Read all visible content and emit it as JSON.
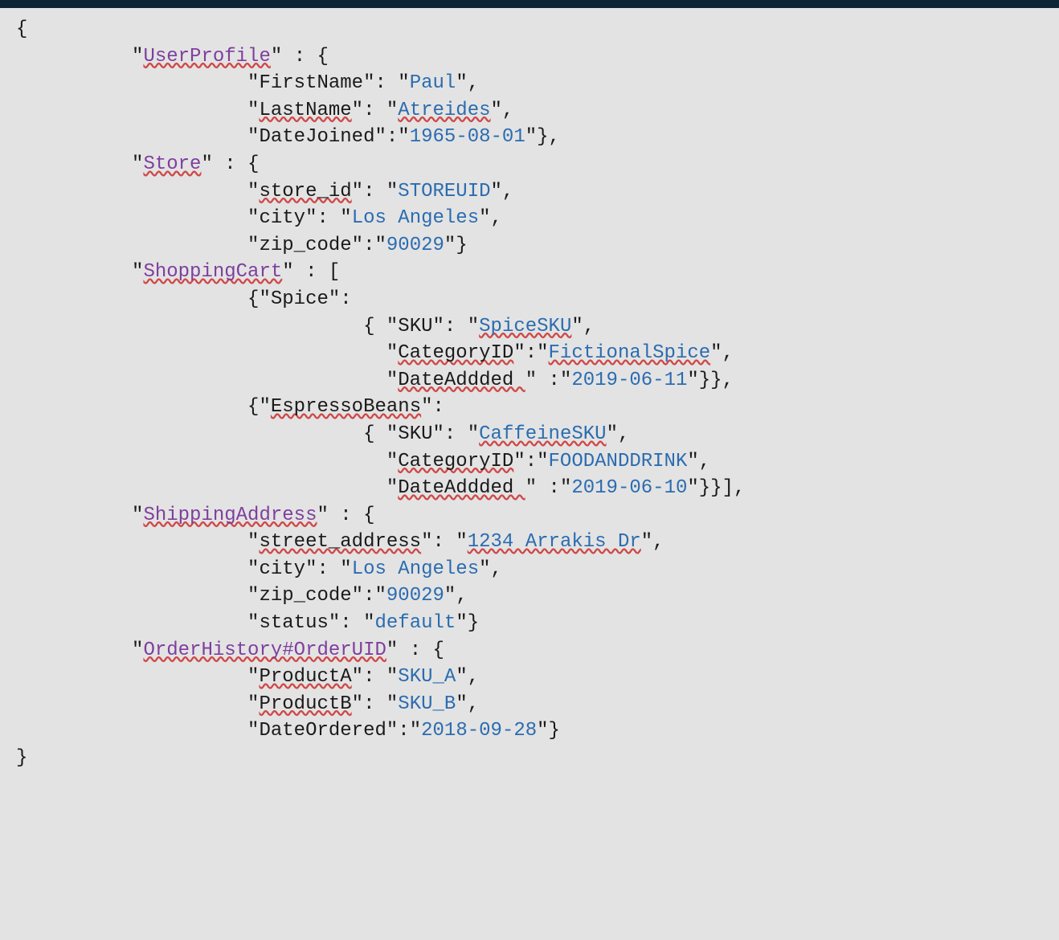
{
  "userProfile": {
    "key": "UserProfile",
    "firstNameKey": "FirstName",
    "firstNameVal": "Paul",
    "lastNameKey": "LastName",
    "lastNameVal": "Atreides",
    "dateJoinedKey": "DateJoined",
    "dateJoinedVal": "1965-08-01"
  },
  "store": {
    "key": "Store",
    "storeIdKey": "store_id",
    "storeIdVal": "STOREUID",
    "cityKey": "city",
    "cityVal": "Los Angeles",
    "zipKey": "zip_code",
    "zipVal": "90029"
  },
  "shoppingCart": {
    "key": "ShoppingCart",
    "item1": {
      "name": "Spice",
      "skuKey": "SKU",
      "skuVal": "SpiceSKU",
      "catKey": "CategoryID",
      "catVal": "FictionalSpice",
      "dateKey": "DateAddded ",
      "dateVal": "2019-06-11"
    },
    "item2": {
      "name": "EspressoBeans",
      "skuKey": "SKU",
      "skuVal": "CaffeineSKU",
      "catKey": "CategoryID",
      "catVal": "FOODANDDRINK",
      "dateKey": "DateAddded ",
      "dateVal": "2019-06-10"
    }
  },
  "shipping": {
    "key": "ShippingAddress",
    "streetKey": "street_address",
    "streetVal": "1234 Arrakis Dr",
    "cityKey": "city",
    "cityVal": "Los Angeles",
    "zipKey": "zip_code",
    "zipVal": "90029",
    "statusKey": "status",
    "statusVal": "default"
  },
  "orderHistory": {
    "key": "OrderHistory#OrderUID",
    "productAKey": "ProductA",
    "productAVal": "SKU_A",
    "productBKey": "ProductB",
    "productBVal": "SKU_B",
    "dateOrderedKey": "DateOrdered",
    "dateOrderedVal": "2018-09-28"
  }
}
